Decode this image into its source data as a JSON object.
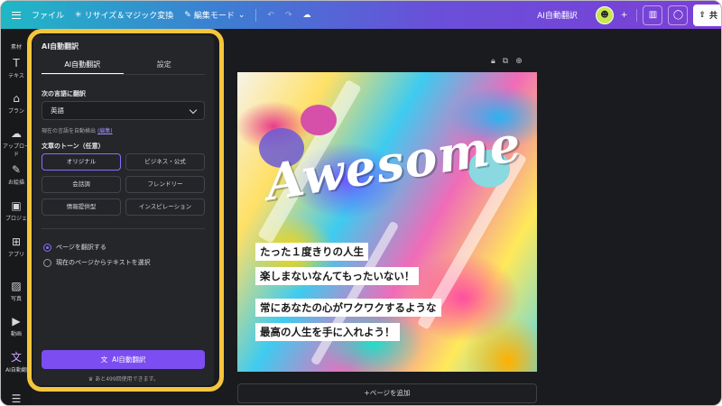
{
  "topbar": {
    "file": "ファイル",
    "resize": "リサイズ＆マジック変換",
    "edit_mode": "編集モード",
    "doc_title": "AI自動翻訳",
    "share": "共"
  },
  "rail": {
    "items": [
      {
        "label": "素材",
        "icon": "elements-icon"
      },
      {
        "label": "テキス",
        "icon": "text-icon"
      },
      {
        "label": "ブラン",
        "icon": "brand-icon"
      },
      {
        "label": "アップロード",
        "icon": "upload-icon"
      },
      {
        "label": "お絵描",
        "icon": "draw-icon"
      },
      {
        "label": "プロジェ",
        "icon": "projects-icon"
      },
      {
        "label": "アプリ",
        "icon": "apps-icon"
      },
      {
        "label": "写真",
        "icon": "photo-icon"
      },
      {
        "label": "動画",
        "icon": "video-icon"
      },
      {
        "label": "AI自動翻",
        "icon": "translate-icon"
      }
    ]
  },
  "panel": {
    "title": "AI自動翻訳",
    "tabs": [
      "AI自動翻訳",
      "設定"
    ],
    "translate_to_label": "次の言語に翻訳",
    "language_value": "英語",
    "detect_text": "現在の言語を自動検出",
    "edit_link": "(編集)",
    "tone_label": "文章のトーン（任意）",
    "tones": [
      "オリジナル",
      "ビジネス・公式",
      "会話調",
      "フレンドリー",
      "情報提供型",
      "インスピレーション"
    ],
    "selected_tone": "オリジナル",
    "options": [
      "ページを翻訳する",
      "現在のページからテキストを選択"
    ],
    "translate_button": "AI自動翻訳",
    "remaining": "あと499回使用できます。"
  },
  "canvas": {
    "headline": "Awesome !",
    "lines": [
      "たった１度きりの人生",
      "楽しまないなんてもったいない！",
      "常にあなたの心がワクワクするような",
      "最高の人生を手に入れよう！"
    ],
    "add_page": "+ページを追加"
  },
  "colors": {
    "accent": "#7c4df1",
    "highlight": "#f5c63c"
  }
}
